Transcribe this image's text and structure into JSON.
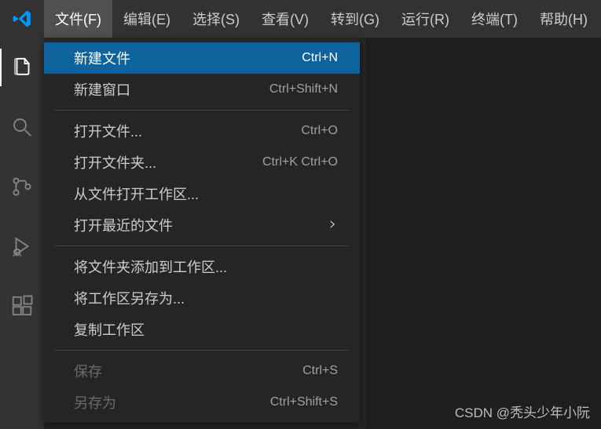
{
  "menubar": {
    "items": [
      {
        "label": "文件(F)"
      },
      {
        "label": "编辑(E)"
      },
      {
        "label": "选择(S)"
      },
      {
        "label": "查看(V)"
      },
      {
        "label": "转到(G)"
      },
      {
        "label": "运行(R)"
      },
      {
        "label": "终端(T)"
      },
      {
        "label": "帮助(H)"
      }
    ]
  },
  "dropdown": {
    "items": [
      {
        "label": "新建文件",
        "shortcut": "Ctrl+N",
        "highlighted": true
      },
      {
        "label": "新建窗口",
        "shortcut": "Ctrl+Shift+N"
      },
      {
        "type": "separator"
      },
      {
        "label": "打开文件...",
        "shortcut": "Ctrl+O"
      },
      {
        "label": "打开文件夹...",
        "shortcut": "Ctrl+K Ctrl+O"
      },
      {
        "label": "从文件打开工作区..."
      },
      {
        "label": "打开最近的文件",
        "submenu": true
      },
      {
        "type": "separator"
      },
      {
        "label": "将文件夹添加到工作区..."
      },
      {
        "label": "将工作区另存为..."
      },
      {
        "label": "复制工作区"
      },
      {
        "type": "separator"
      },
      {
        "label": "保存",
        "shortcut": "Ctrl+S",
        "disabled": true
      },
      {
        "label": "另存为",
        "shortcut": "Ctrl+Shift+S",
        "disabled": true
      }
    ]
  },
  "watermark": "CSDN @秃头少年小阮"
}
